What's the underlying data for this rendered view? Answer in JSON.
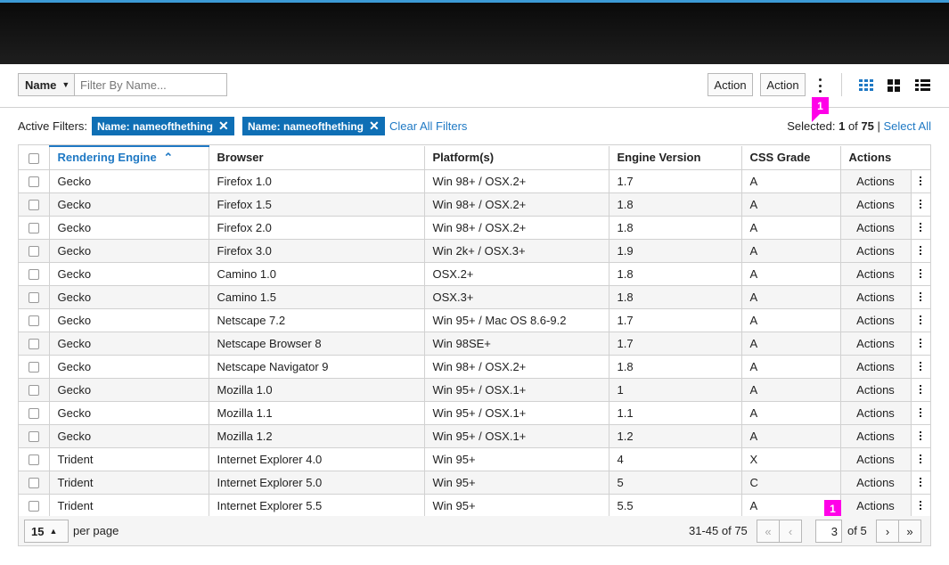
{
  "toolbar": {
    "name_dropdown": "Name",
    "filter_placeholder": "Filter By Name...",
    "action1": "Action",
    "action2": "Action"
  },
  "filters": {
    "label": "Active Filters:",
    "chips": [
      "Name: nameofthething",
      "Name: nameofthething"
    ],
    "clear_all": "Clear All Filters",
    "selected_label": "Selected:",
    "selected_count": "1",
    "selected_of": "of",
    "selected_total": "75",
    "select_all": "Select All"
  },
  "badges": [
    "1",
    "1"
  ],
  "table": {
    "columns": [
      "Rendering Engine",
      "Browser",
      "Platform(s)",
      "Engine Version",
      "CSS Grade",
      "Actions"
    ],
    "sort_indicator": "⌃",
    "action_label": "Actions",
    "rows": [
      [
        "Gecko",
        "Firefox 1.0",
        "Win 98+ / OSX.2+",
        "1.7",
        "A"
      ],
      [
        "Gecko",
        "Firefox 1.5",
        "Win 98+ / OSX.2+",
        "1.8",
        "A"
      ],
      [
        "Gecko",
        "Firefox 2.0",
        "Win 98+ / OSX.2+",
        "1.8",
        "A"
      ],
      [
        "Gecko",
        "Firefox 3.0",
        "Win 2k+ / OSX.3+",
        "1.9",
        "A"
      ],
      [
        "Gecko",
        "Camino 1.0",
        "OSX.2+",
        "1.8",
        "A"
      ],
      [
        "Gecko",
        "Camino 1.5",
        "OSX.3+",
        "1.8",
        "A"
      ],
      [
        "Gecko",
        "Netscape 7.2",
        "Win 95+ / Mac OS 8.6-9.2",
        "1.7",
        "A"
      ],
      [
        "Gecko",
        "Netscape Browser 8",
        "Win 98SE+",
        "1.7",
        "A"
      ],
      [
        "Gecko",
        "Netscape Navigator 9",
        "Win 98+ / OSX.2+",
        "1.8",
        "A"
      ],
      [
        "Gecko",
        "Mozilla 1.0",
        "Win 95+ / OSX.1+",
        "1",
        "A"
      ],
      [
        "Gecko",
        "Mozilla 1.1",
        "Win 95+ / OSX.1+",
        "1.1",
        "A"
      ],
      [
        "Gecko",
        "Mozilla 1.2",
        "Win 95+ / OSX.1+",
        "1.2",
        "A"
      ],
      [
        "Trident",
        "Internet Explorer 4.0",
        "Win 95+",
        "4",
        "X"
      ],
      [
        "Trident",
        "Internet Explorer 5.0",
        "Win 95+",
        "5",
        "C"
      ],
      [
        "Trident",
        "Internet Explorer 5.5",
        "Win 95+",
        "5.5",
        "A"
      ]
    ]
  },
  "footer": {
    "per_page": "15",
    "per_page_label": "per page",
    "range": "31-45 of 75",
    "current_page": "3",
    "of_pages": "of 5",
    "first": "«",
    "prev": "‹",
    "next": "›",
    "last": "»"
  },
  "colors": {
    "accent": "#1f79c4",
    "chip": "#0f6fb5",
    "badge": "#ff00e8"
  }
}
